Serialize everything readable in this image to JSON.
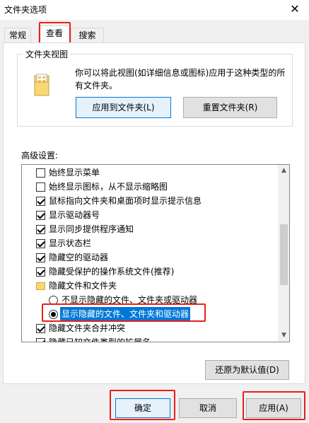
{
  "window": {
    "title": "文件夹选项",
    "close_symbol": "✕"
  },
  "tabs": [
    {
      "label": "常规"
    },
    {
      "label": "查看"
    },
    {
      "label": "搜索"
    }
  ],
  "folder_view": {
    "group_label": "文件夹视图",
    "description": "你可以将此视图(如详细信息或图标)应用于这种类型的所有文件夹。",
    "apply_button": "应用到文件夹(L)",
    "reset_button": "重置文件夹(R)"
  },
  "advanced": {
    "label": "高级设置:",
    "items": [
      {
        "type": "checkbox",
        "checked": false,
        "label": "始终显示菜单"
      },
      {
        "type": "checkbox",
        "checked": false,
        "label": "始终显示图标，从不显示缩略图"
      },
      {
        "type": "checkbox",
        "checked": true,
        "label": "鼠标指向文件夹和桌面项时显示提示信息"
      },
      {
        "type": "checkbox",
        "checked": true,
        "label": "显示驱动器号"
      },
      {
        "type": "checkbox",
        "checked": true,
        "label": "显示同步提供程序通知"
      },
      {
        "type": "checkbox",
        "checked": true,
        "label": "显示状态栏"
      },
      {
        "type": "checkbox",
        "checked": true,
        "label": "隐藏空的驱动器"
      },
      {
        "type": "checkbox",
        "checked": true,
        "label": "隐藏受保护的操作系统文件(推荐)"
      },
      {
        "type": "folder",
        "label": "隐藏文件和文件夹"
      },
      {
        "type": "radio",
        "selected": false,
        "label": "不显示隐藏的文件、文件夹或驱动器"
      },
      {
        "type": "radio",
        "selected": true,
        "label": "显示隐藏的文件、文件夹和驱动器"
      },
      {
        "type": "checkbox",
        "checked": true,
        "label": "隐藏文件夹合并冲突"
      },
      {
        "type": "checkbox",
        "checked": true,
        "label": "隐藏已知文件类型的扩展名"
      }
    ],
    "restore_button": "还原为默认值(D)"
  },
  "footer": {
    "ok_button": "确定",
    "cancel_button": "取消",
    "apply_button": "应用(A)"
  },
  "colors": {
    "highlight_box": "#e8201d",
    "selection": "#0078d7"
  }
}
